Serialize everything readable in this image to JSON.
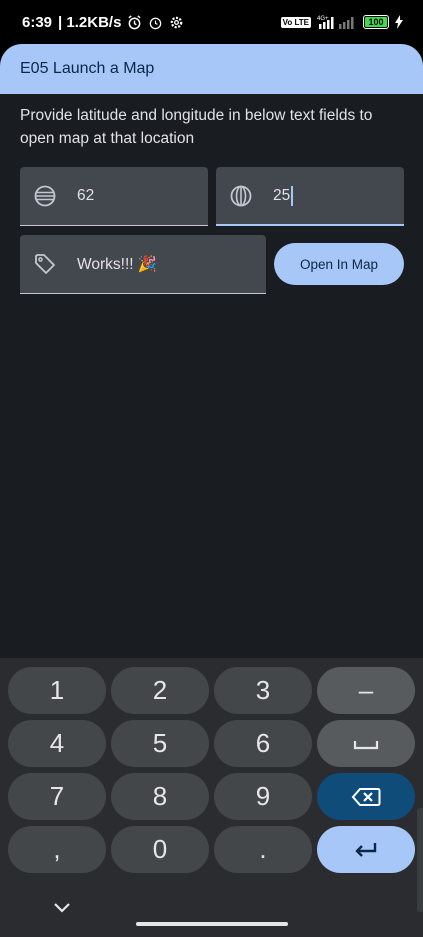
{
  "status_bar": {
    "time": "6:39",
    "network_speed": "| 1.2KB/s",
    "net_type": "4G+",
    "vo_badge": "Vo LTE",
    "battery": "100"
  },
  "app": {
    "title": "E05 Launch a Map",
    "description": "Provide latitude and longitude in below text fields to open map at that location",
    "latitude_value": "62",
    "longitude_value": "25",
    "message_value": "Works!!! 🎉",
    "open_button_label": "Open In Map",
    "accent_color": "#a6c7f7"
  },
  "keyboard": {
    "keys": [
      "1",
      "2",
      "3",
      "–",
      "4",
      "5",
      "6",
      "␣",
      "7",
      "8",
      "9",
      "⌫",
      ",",
      "0",
      ".",
      "↵"
    ]
  }
}
